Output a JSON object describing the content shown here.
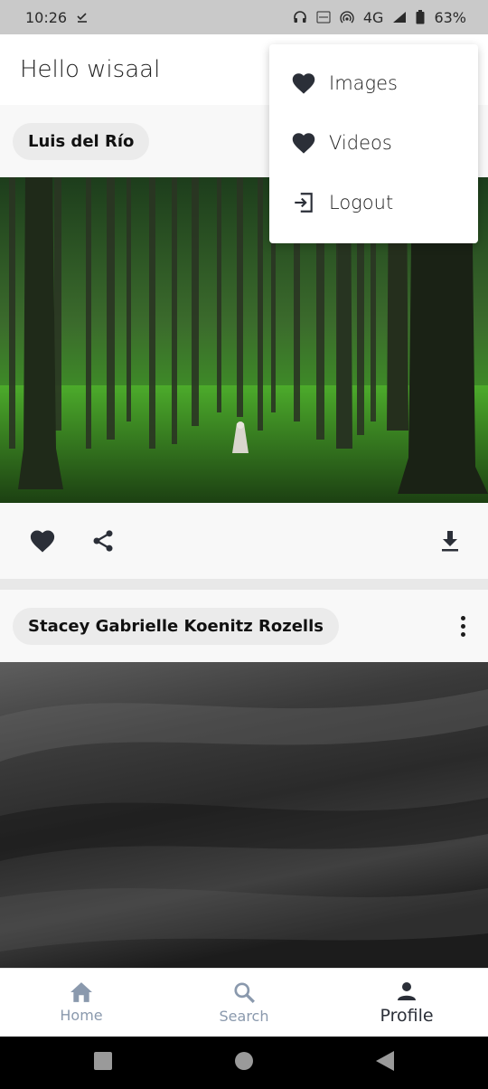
{
  "status_bar": {
    "time": "10:26",
    "network": "4G",
    "battery": "63%"
  },
  "app_bar": {
    "greeting": "Hello wisaal"
  },
  "posts": [
    {
      "author": "Luis del Río"
    },
    {
      "author": "Stacey Gabrielle Koenitz Rozells"
    }
  ],
  "overflow_menu": {
    "items": [
      {
        "label": "Images",
        "icon": "heart-icon"
      },
      {
        "label": "Videos",
        "icon": "heart-icon"
      },
      {
        "label": "Logout",
        "icon": "logout-icon"
      }
    ]
  },
  "bottom_nav": {
    "items": [
      {
        "label": "Home",
        "icon": "home-icon"
      },
      {
        "label": "Search",
        "icon": "search-icon"
      },
      {
        "label": "Profile",
        "icon": "person-icon"
      }
    ],
    "active": "Profile"
  },
  "colors": {
    "icon_dark": "#2b2f38",
    "nav_inactive": "#8a99ad",
    "status_bar_bg": "#c9c9c9"
  }
}
